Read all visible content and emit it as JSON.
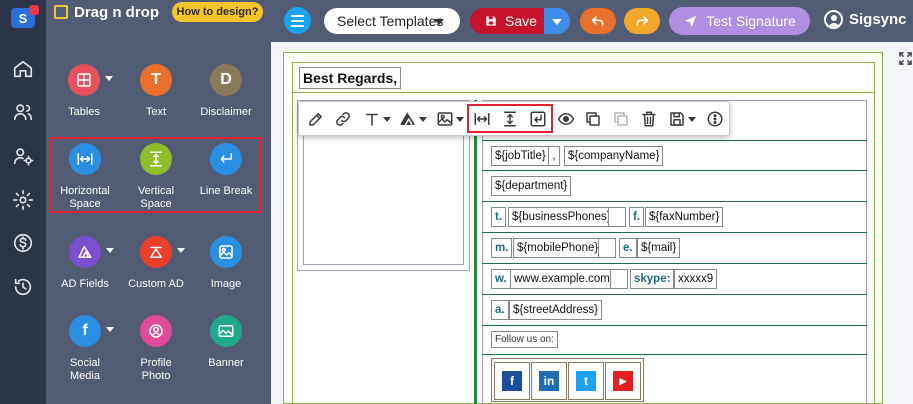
{
  "app": {
    "rail_logo_letter": "S",
    "rail_icons": [
      "home-icon",
      "users-icon",
      "user-settings-icon",
      "gear-icon",
      "dollar-icon",
      "history-icon"
    ]
  },
  "panel": {
    "title": "Drag n drop",
    "how_to_label": "How to design?",
    "tiles": [
      {
        "label": "Tables",
        "icon": "table-icon",
        "color": "#e8505b",
        "has_caret": true
      },
      {
        "label": "Text",
        "icon": "text-icon",
        "glyph": "T",
        "color": "#e8702a",
        "has_caret": false
      },
      {
        "label": "Disclaimer",
        "icon": "disclaimer-icon",
        "glyph": "D",
        "color": "#8a7a5a",
        "has_caret": false
      },
      {
        "label": "Horizontal Space",
        "icon": "horizontal-space-icon",
        "color": "#2a8fe0",
        "has_caret": false
      },
      {
        "label": "Vertical Space",
        "icon": "vertical-space-icon",
        "color": "#8cbf2a",
        "has_caret": false
      },
      {
        "label": "Line Break",
        "icon": "line-break-icon",
        "color": "#2a8fe0",
        "has_caret": false
      },
      {
        "label": "AD Fields",
        "icon": "ad-fields-icon",
        "color": "#7a4fd0",
        "has_caret": true
      },
      {
        "label": "Custom AD",
        "icon": "custom-ad-icon",
        "color": "#e8402a",
        "has_caret": true
      },
      {
        "label": "Image",
        "icon": "image-icon",
        "color": "#2a8fe0",
        "has_caret": false
      },
      {
        "label": "Social Media",
        "icon": "social-media-icon",
        "glyph": "f",
        "color": "#2a8fe0",
        "has_caret": true
      },
      {
        "label": "Profile Photo",
        "icon": "profile-photo-icon",
        "color": "#e04a9a",
        "has_caret": false
      },
      {
        "label": "Banner",
        "icon": "banner-icon",
        "color": "#1fa98a",
        "has_caret": false
      }
    ]
  },
  "toolbar": {
    "select_templates_label": "Select Templates",
    "save_label": "Save",
    "test_signature_label": "Test Signature",
    "user_name": "Sigsync"
  },
  "signature": {
    "regards": "Best Regards,",
    "job_title": "${jobTitle}",
    "comma": ",",
    "company_name": "${companyName}",
    "department": "${department}",
    "phone_key": "t.",
    "business_phones": "${businessPhones}",
    "fax_key": "f.",
    "fax_number": "${faxNumber}",
    "mobile_key": "m.",
    "mobile_phone": "${mobilePhone}",
    "email_key": "e.",
    "mail": "${mail}",
    "web_key": "w.",
    "website": "www.example.com",
    "skype_key": "skype:",
    "skype_value": "xxxxx9",
    "address_key": "a.",
    "street_address": "${streetAddress}",
    "follow_us": "Follow us on:",
    "social_icons": [
      {
        "name": "facebook-icon",
        "glyph": "f",
        "color": "#1b4f9c"
      },
      {
        "name": "linkedin-icon",
        "glyph": "in",
        "color": "#1f6fb0"
      },
      {
        "name": "twitter-icon",
        "glyph": "t",
        "color": "#1da1f2"
      },
      {
        "name": "youtube-icon",
        "glyph": "▶",
        "color": "#e02020"
      }
    ]
  },
  "floating_toolbar": {
    "buttons": [
      "edit-icon",
      "link-icon",
      "font-icon",
      "color-icon",
      "image-icon",
      "horizontal-space-icon",
      "vertical-space-icon",
      "line-break-icon",
      "preview-icon",
      "duplicate-icon",
      "paste-icon",
      "delete-icon",
      "save-block-icon",
      "more-icon"
    ]
  }
}
